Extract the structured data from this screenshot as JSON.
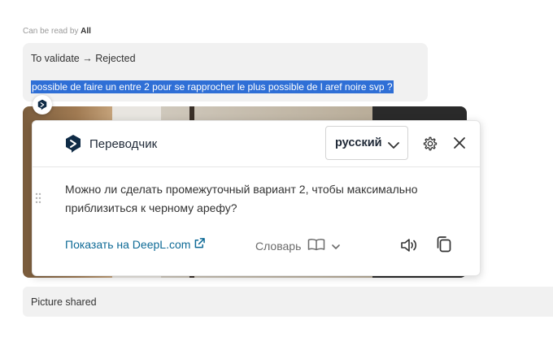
{
  "chat": {
    "read_by_prefix": "Can be read by",
    "read_by_value": "All",
    "status_line": "To validate → Rejected",
    "selected_text": "possible de faire un entre 2 pour se rapprocher le plus possible de l aref noire svp ?",
    "picture_shared": "Picture shared"
  },
  "translator": {
    "title": "Переводчик",
    "language": "русский",
    "translation_line1": "Можно ли сделать промежуточный вариант 2, чтобы максимально",
    "translation_line2": "приблизиться к черному арефу?",
    "show_on_deepl": "Показать на DeepL.com",
    "dictionary": "Словарь"
  },
  "colors": {
    "selection": "#2f6fd6",
    "link": "#0e6a96",
    "deepl_navy": "#0f2b46"
  }
}
